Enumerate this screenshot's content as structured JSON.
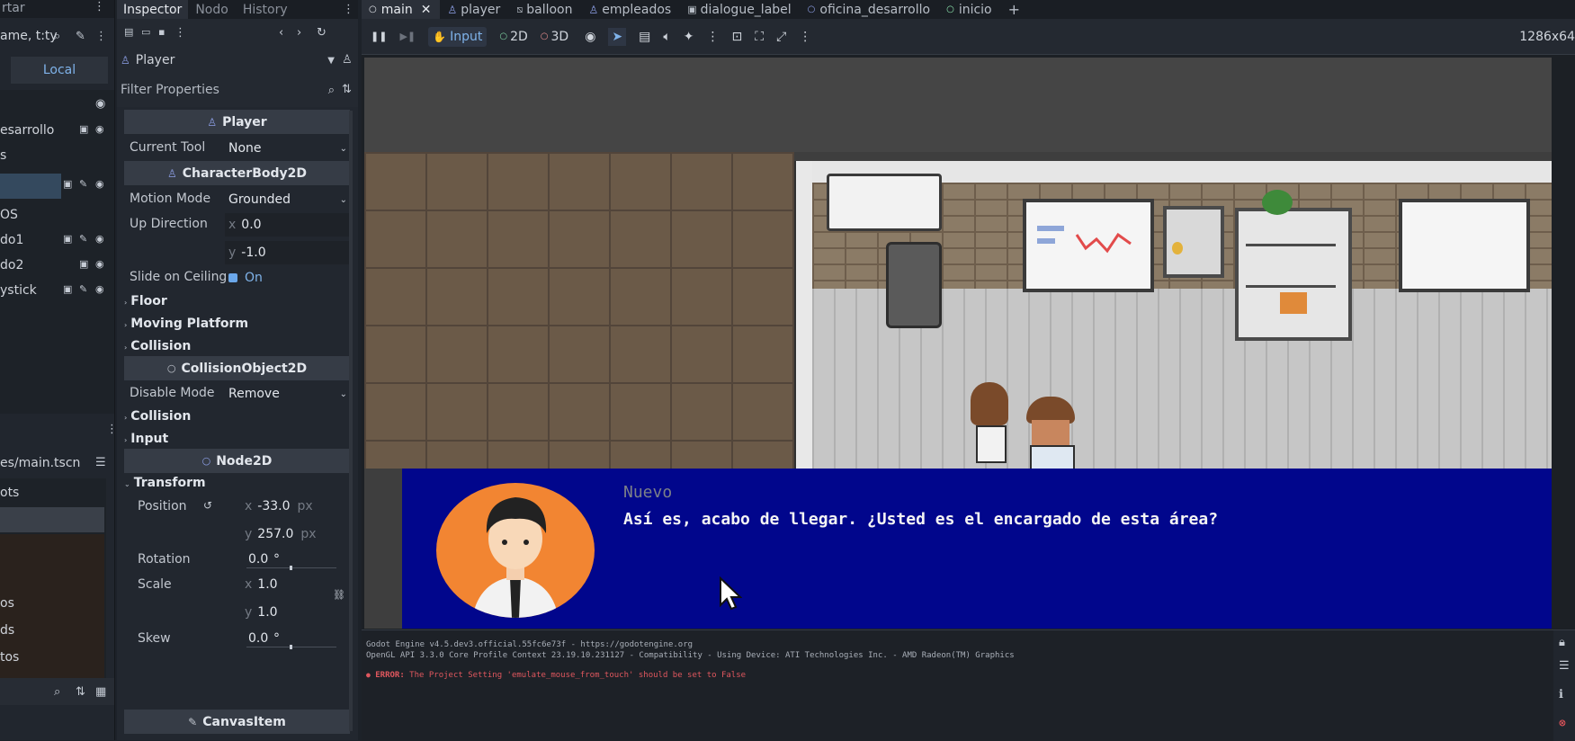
{
  "scene_dock": {
    "top_label": "rtar",
    "filter_placeholder": "ame, t:ty",
    "local_tab": "Local",
    "nodes": [
      "esarrollo",
      "s",
      "",
      "OS",
      "do1",
      "do2",
      "ystick"
    ],
    "file_path": "es/main.tscn",
    "files": [
      "ots",
      "",
      "os",
      "ds",
      "tos"
    ]
  },
  "inspector": {
    "tabs": [
      "Inspector",
      "Nodo",
      "History"
    ],
    "node_name": "Player",
    "filter_placeholder": "Filter Properties",
    "sections": {
      "player": "Player",
      "character_body": "CharacterBody2D",
      "collision_object": "CollisionObject2D",
      "node2d": "Node2D",
      "canvas_item": "CanvasItem"
    },
    "props": {
      "current_tool_label": "Current Tool",
      "current_tool_value": "None",
      "motion_mode_label": "Motion Mode",
      "motion_mode_value": "Grounded",
      "up_direction_label": "Up Direction",
      "up_x_axis": "x",
      "up_x": "0.0",
      "up_y_axis": "y",
      "up_y": "-1.0",
      "slide_label": "Slide on Ceiling",
      "slide_value": "On",
      "floor": "Floor",
      "moving_platform": "Moving Platform",
      "collision1": "Collision",
      "disable_mode_label": "Disable Mode",
      "disable_mode_value": "Remove",
      "collision2": "Collision",
      "input": "Input",
      "transform": "Transform",
      "position_label": "Position",
      "pos_x_axis": "x",
      "pos_x": "-33.0",
      "pos_y_axis": "y",
      "pos_y": "257.0",
      "unit_px": "px",
      "rotation_label": "Rotation",
      "rotation_value": "0.0",
      "rotation_unit": "°",
      "scale_label": "Scale",
      "scale_x_axis": "x",
      "scale_x": "1.0",
      "scale_y_axis": "y",
      "scale_y": "1.0",
      "skew_label": "Skew",
      "skew_value": "0.0",
      "skew_unit": "°"
    }
  },
  "tabs": [
    "main",
    "player",
    "balloon",
    "empleados",
    "dialogue_label",
    "oficina_desarrollo",
    "inicio"
  ],
  "toolbar": {
    "input": "Input",
    "mode_2d": "2D",
    "mode_3d": "3D",
    "resolution": "1286x64"
  },
  "dialogue": {
    "speaker": "Nuevo",
    "text": "Así es, acabo de llegar. ¿Usted es el encargado de esta área?"
  },
  "console": {
    "line1": "Godot Engine v4.5.dev3.official.55fc6e73f - https://godotengine.org",
    "line2": "OpenGL API 3.3.0 Core Profile Context 23.19.10.231127 - Compatibility - Using Device: ATI Technologies Inc. - AMD Radeon(TM) Graphics",
    "error_tag": "ERROR:",
    "error_text": " The Project Setting 'emulate_mouse_from_touch' should be set to False"
  },
  "colors": {
    "accent": "#6ba7ea",
    "dialogue_bg": "#01068c",
    "avatar_bg": "#f28532",
    "error": "#f0575e"
  }
}
